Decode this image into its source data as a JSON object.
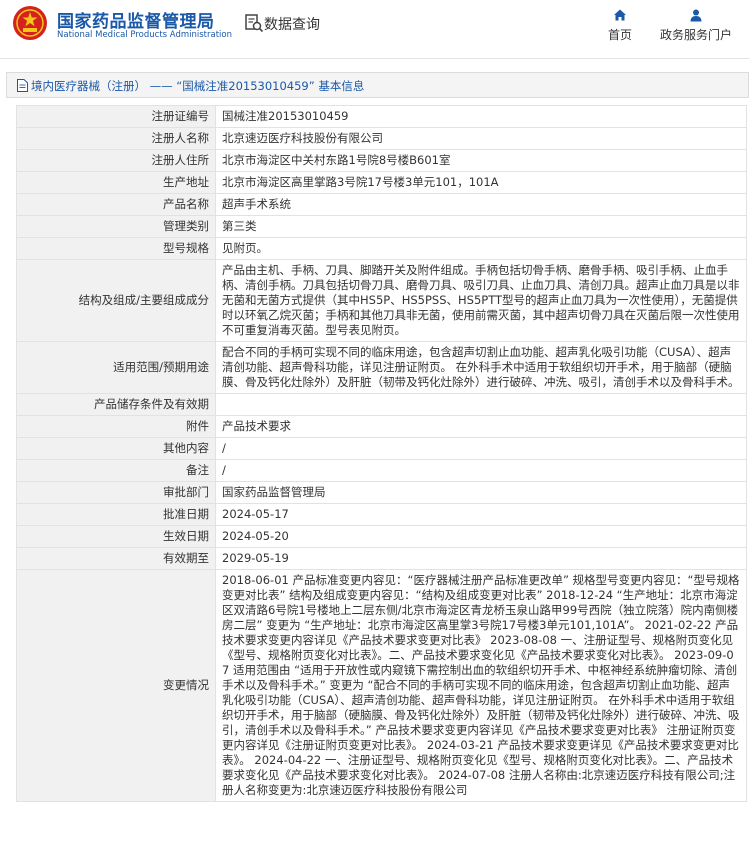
{
  "header": {
    "brand_cn": "国家药品监督管理局",
    "brand_en": "National Medical Products Administration",
    "query_label": "数据查询",
    "nav": [
      {
        "label": "首页",
        "icon": "home-icon"
      },
      {
        "label": "政务服务门户",
        "icon": "user-icon"
      }
    ],
    "brand_color": "#1a58a8"
  },
  "breadcrumb": {
    "text": "境内医疗器械（注册） —— “国械注准20153010459” 基本信息"
  },
  "rows": [
    {
      "label": "注册证编号",
      "value": "国械注准20153010459"
    },
    {
      "label": "注册人名称",
      "value": "北京速迈医疗科技股份有限公司"
    },
    {
      "label": "注册人住所",
      "value": "北京市海淀区中关村东路1号院8号楼B601室"
    },
    {
      "label": "生产地址",
      "value": "北京市海淀区高里掌路3号院17号楼3单元101，101A"
    },
    {
      "label": "产品名称",
      "value": "超声手术系统"
    },
    {
      "label": "管理类别",
      "value": "第三类"
    },
    {
      "label": "型号规格",
      "value": "见附页。"
    },
    {
      "label": "结构及组成/主要组成成分",
      "value": "产品由主机、手柄、刀具、脚踏开关及附件组成。手柄包括切骨手柄、磨骨手柄、吸引手柄、止血手柄、清创手柄。刀具包括切骨刀具、磨骨刀具、吸引刀具、止血刀具、清创刀具。超声止血刀具是以非无菌和无菌方式提供（其中HS5P、HS5PSS、HS5PTT型号的超声止血刀具为一次性使用），无菌提供时以环氧乙烷灭菌；手柄和其他刀具非无菌，使用前需灭菌，其中超声切骨刀具在灭菌后限一次性使用不可重复消毒灭菌。型号表见附页。"
    },
    {
      "label": "适用范围/预期用途",
      "value": "配合不同的手柄可实现不同的临床用途，包含超声切割止血功能、超声乳化吸引功能（CUSA）、超声清创功能、超声骨科功能，详见注册证附页。 在外科手术中适用于软组织切开手术，用于脑部（硬脑膜、骨及钙化灶除外）及肝脏（韧带及钙化灶除外）进行破碎、冲洗、吸引，清创手术以及骨科手术。"
    },
    {
      "label": "产品储存条件及有效期",
      "value": ""
    },
    {
      "label": "附件",
      "value": "产品技术要求"
    },
    {
      "label": "其他内容",
      "value": "/"
    },
    {
      "label": "备注",
      "value": "/"
    },
    {
      "label": "审批部门",
      "value": "国家药品监督管理局"
    },
    {
      "label": "批准日期",
      "value": "2024-05-17"
    },
    {
      "label": "生效日期",
      "value": "2024-05-20"
    },
    {
      "label": "有效期至",
      "value": "2029-05-19"
    },
    {
      "label": "变更情况",
      "value": "2018-06-01 产品标准变更内容见：“医疗器械注册产品标准更改单” 规格型号变更内容见：“型号规格变更对比表” 结构及组成变更内容见：“结构及组成变更对比表” 2018-12-24 “生产地址：北京市海淀区双清路6号院1号楼地上二层东侧/北京市海淀区青龙桥玉泉山路甲99号西院（独立院落）院内南侧楼房二层” 变更为 “生产地址：北京市海淀区高里掌3号院17号楼3单元101,101A”。 2021-02-22 产品技术要求变更内容详见《产品技术要求变更对比表》 2023-08-08 一、注册证型号、规格附页变化见《型号、规格附页变化对比表》。二、产品技术要求变化见《产品技术要求变化对比表》。 2023-09-07 适用范围由 “适用于开放性或内窥镜下需控制出血的软组织切开手术、中枢神经系统肿瘤切除、清创手术以及骨科手术。” 变更为 “配合不同的手柄可实现不同的临床用途，包含超声切割止血功能、超声乳化吸引功能（CUSA）、超声清创功能、超声骨科功能，详见注册证附页。 在外科手术中适用于软组织切开手术，用于脑部（硬脑膜、骨及钙化灶除外）及肝脏（韧带及钙化灶除外）进行破碎、冲洗、吸引，清创手术以及骨科手术。” 产品技术要求变更内容详见《产品技术要求变更对比表》 注册证附页变更内容详见《注册证附页变更对比表》。 2024-03-21 产品技术要求变更详见《产品技术要求变更对比表》。 2024-04-22 一、注册证型号、规格附页变化见《型号、规格附页变化对比表》。二、产品技术要求变化见《产品技术要求变化对比表》。 2024-07-08 注册人名称由:北京速迈医疗科技有限公司;注册人名称变更为:北京速迈医疗科技股份有限公司"
    }
  ]
}
